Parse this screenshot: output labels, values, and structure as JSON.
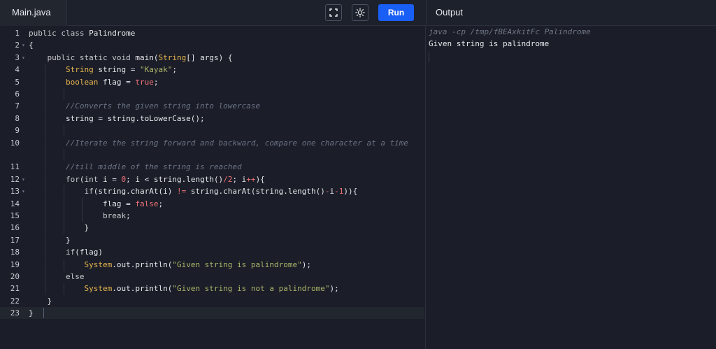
{
  "editor": {
    "tab_label": "Main.java",
    "run_label": "Run",
    "fullscreen_icon": "fullscreen-icon",
    "theme_icon": "sun-icon"
  },
  "output": {
    "title": "Output",
    "command": "java -cp /tmp/fBEAxkitFc Palindrome",
    "result": "Given string is palindrome"
  },
  "code": {
    "line_numbers": [
      "1",
      "2",
      "3",
      "4",
      "5",
      "6",
      "7",
      "8",
      "9",
      "10",
      "",
      "11",
      "12",
      "13",
      "14",
      "15",
      "16",
      "17",
      "18",
      "19",
      "20",
      "21",
      "22",
      "23"
    ],
    "lines": [
      "public class Palindrome",
      "{",
      "    public static void main(String[] args) {",
      "        String string = \"Kayak\";",
      "        boolean flag = true;",
      "",
      "        //Converts the given string into lowercase",
      "        string = string.toLowerCase();",
      "",
      "        //Iterate the string forward and backward, compare one character at a time",
      "",
      "        //till middle of the string is reached",
      "        for(int i = 0; i < string.length()/2; i++){",
      "            if(string.charAt(i) != string.charAt(string.length()-i-1)){",
      "                flag = false;",
      "                break;",
      "            }",
      "        }",
      "        if(flag)",
      "            System.out.println(\"Given string is palindrome\");",
      "        else",
      "            System.out.println(\"Given string is not a palindrome\");",
      "    }",
      "}"
    ]
  },
  "colors": {
    "background": "#1b1e28",
    "run_button": "#1a5ff5",
    "string": "#aab46a",
    "type": "#e6b450",
    "literal": "#f07178",
    "comment": "#6c7386"
  }
}
